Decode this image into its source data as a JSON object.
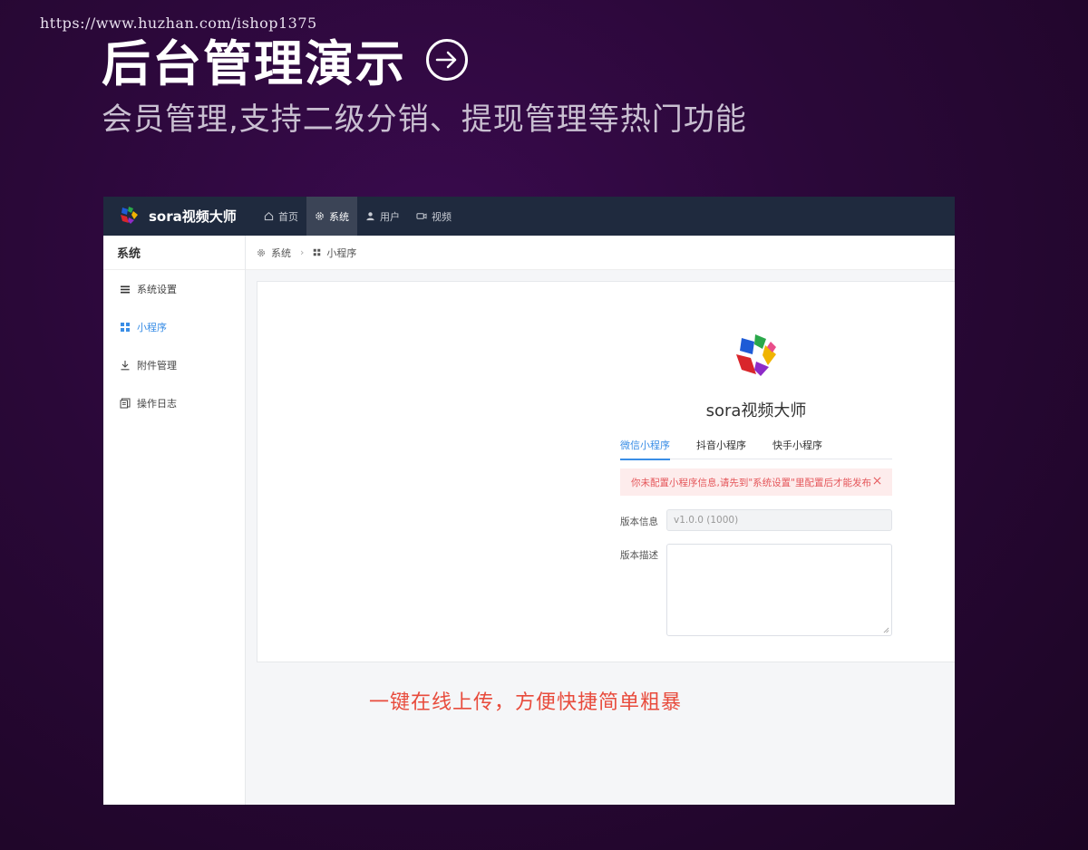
{
  "watermark": "https://www.huzhan.com/ishop1375",
  "hero": {
    "title": "后台管理演示",
    "subtitle": "会员管理,支持二级分销、提现管理等热门功能"
  },
  "app": {
    "brand": "sora视频大师",
    "nav": [
      {
        "label": "首页",
        "icon": "home-icon"
      },
      {
        "label": "系统",
        "icon": "gear-icon",
        "active": true
      },
      {
        "label": "用户",
        "icon": "user-icon"
      },
      {
        "label": "视频",
        "icon": "video-icon"
      }
    ],
    "sidebar": {
      "title": "系统",
      "items": [
        {
          "label": "系统设置",
          "icon": "menu-lines-icon"
        },
        {
          "label": "小程序",
          "icon": "grid-icon",
          "active": true
        },
        {
          "label": "附件管理",
          "icon": "download-icon"
        },
        {
          "label": "操作日志",
          "icon": "log-icon"
        }
      ]
    },
    "breadcrumb": [
      "系统",
      "小程序"
    ],
    "miniprogram": {
      "app_name": "sora视频大师",
      "tabs": [
        "微信小程序",
        "抖音小程序",
        "快手小程序"
      ],
      "alert": "你未配置小程序信息,请先到\"系统设置\"里配置后才能发布",
      "version_label": "版本信息",
      "version_value": "v1.0.0 (1000)",
      "desc_label": "版本描述"
    },
    "caption": "一键在线上传，方便快捷简单粗暴"
  },
  "colors": {
    "background": "#2a0838",
    "topbar": "#1f2a3e",
    "accent": "#3a8ee6",
    "alert_text": "#e5565a",
    "caption": "#e84b3c"
  }
}
